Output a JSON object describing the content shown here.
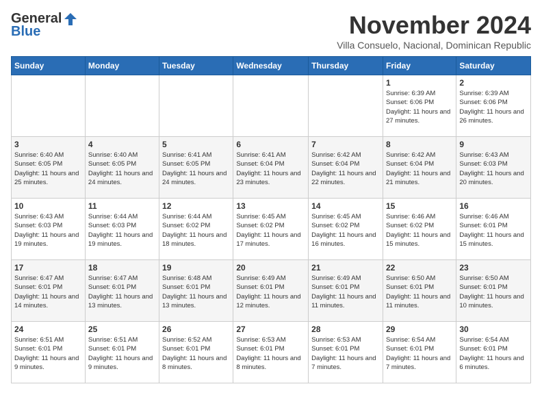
{
  "logo": {
    "general": "General",
    "blue": "Blue"
  },
  "title": {
    "month": "November 2024",
    "subtitle": "Villa Consuelo, Nacional, Dominican Republic"
  },
  "weekdays": [
    "Sunday",
    "Monday",
    "Tuesday",
    "Wednesday",
    "Thursday",
    "Friday",
    "Saturday"
  ],
  "weeks": [
    [
      {
        "day": "",
        "info": ""
      },
      {
        "day": "",
        "info": ""
      },
      {
        "day": "",
        "info": ""
      },
      {
        "day": "",
        "info": ""
      },
      {
        "day": "",
        "info": ""
      },
      {
        "day": "1",
        "info": "Sunrise: 6:39 AM\nSunset: 6:06 PM\nDaylight: 11 hours and 27 minutes."
      },
      {
        "day": "2",
        "info": "Sunrise: 6:39 AM\nSunset: 6:06 PM\nDaylight: 11 hours and 26 minutes."
      }
    ],
    [
      {
        "day": "3",
        "info": "Sunrise: 6:40 AM\nSunset: 6:05 PM\nDaylight: 11 hours and 25 minutes."
      },
      {
        "day": "4",
        "info": "Sunrise: 6:40 AM\nSunset: 6:05 PM\nDaylight: 11 hours and 24 minutes."
      },
      {
        "day": "5",
        "info": "Sunrise: 6:41 AM\nSunset: 6:05 PM\nDaylight: 11 hours and 24 minutes."
      },
      {
        "day": "6",
        "info": "Sunrise: 6:41 AM\nSunset: 6:04 PM\nDaylight: 11 hours and 23 minutes."
      },
      {
        "day": "7",
        "info": "Sunrise: 6:42 AM\nSunset: 6:04 PM\nDaylight: 11 hours and 22 minutes."
      },
      {
        "day": "8",
        "info": "Sunrise: 6:42 AM\nSunset: 6:04 PM\nDaylight: 11 hours and 21 minutes."
      },
      {
        "day": "9",
        "info": "Sunrise: 6:43 AM\nSunset: 6:03 PM\nDaylight: 11 hours and 20 minutes."
      }
    ],
    [
      {
        "day": "10",
        "info": "Sunrise: 6:43 AM\nSunset: 6:03 PM\nDaylight: 11 hours and 19 minutes."
      },
      {
        "day": "11",
        "info": "Sunrise: 6:44 AM\nSunset: 6:03 PM\nDaylight: 11 hours and 19 minutes."
      },
      {
        "day": "12",
        "info": "Sunrise: 6:44 AM\nSunset: 6:02 PM\nDaylight: 11 hours and 18 minutes."
      },
      {
        "day": "13",
        "info": "Sunrise: 6:45 AM\nSunset: 6:02 PM\nDaylight: 11 hours and 17 minutes."
      },
      {
        "day": "14",
        "info": "Sunrise: 6:45 AM\nSunset: 6:02 PM\nDaylight: 11 hours and 16 minutes."
      },
      {
        "day": "15",
        "info": "Sunrise: 6:46 AM\nSunset: 6:02 PM\nDaylight: 11 hours and 15 minutes."
      },
      {
        "day": "16",
        "info": "Sunrise: 6:46 AM\nSunset: 6:01 PM\nDaylight: 11 hours and 15 minutes."
      }
    ],
    [
      {
        "day": "17",
        "info": "Sunrise: 6:47 AM\nSunset: 6:01 PM\nDaylight: 11 hours and 14 minutes."
      },
      {
        "day": "18",
        "info": "Sunrise: 6:47 AM\nSunset: 6:01 PM\nDaylight: 11 hours and 13 minutes."
      },
      {
        "day": "19",
        "info": "Sunrise: 6:48 AM\nSunset: 6:01 PM\nDaylight: 11 hours and 13 minutes."
      },
      {
        "day": "20",
        "info": "Sunrise: 6:49 AM\nSunset: 6:01 PM\nDaylight: 11 hours and 12 minutes."
      },
      {
        "day": "21",
        "info": "Sunrise: 6:49 AM\nSunset: 6:01 PM\nDaylight: 11 hours and 11 minutes."
      },
      {
        "day": "22",
        "info": "Sunrise: 6:50 AM\nSunset: 6:01 PM\nDaylight: 11 hours and 11 minutes."
      },
      {
        "day": "23",
        "info": "Sunrise: 6:50 AM\nSunset: 6:01 PM\nDaylight: 11 hours and 10 minutes."
      }
    ],
    [
      {
        "day": "24",
        "info": "Sunrise: 6:51 AM\nSunset: 6:01 PM\nDaylight: 11 hours and 9 minutes."
      },
      {
        "day": "25",
        "info": "Sunrise: 6:51 AM\nSunset: 6:01 PM\nDaylight: 11 hours and 9 minutes."
      },
      {
        "day": "26",
        "info": "Sunrise: 6:52 AM\nSunset: 6:01 PM\nDaylight: 11 hours and 8 minutes."
      },
      {
        "day": "27",
        "info": "Sunrise: 6:53 AM\nSunset: 6:01 PM\nDaylight: 11 hours and 8 minutes."
      },
      {
        "day": "28",
        "info": "Sunrise: 6:53 AM\nSunset: 6:01 PM\nDaylight: 11 hours and 7 minutes."
      },
      {
        "day": "29",
        "info": "Sunrise: 6:54 AM\nSunset: 6:01 PM\nDaylight: 11 hours and 7 minutes."
      },
      {
        "day": "30",
        "info": "Sunrise: 6:54 AM\nSunset: 6:01 PM\nDaylight: 11 hours and 6 minutes."
      }
    ]
  ]
}
